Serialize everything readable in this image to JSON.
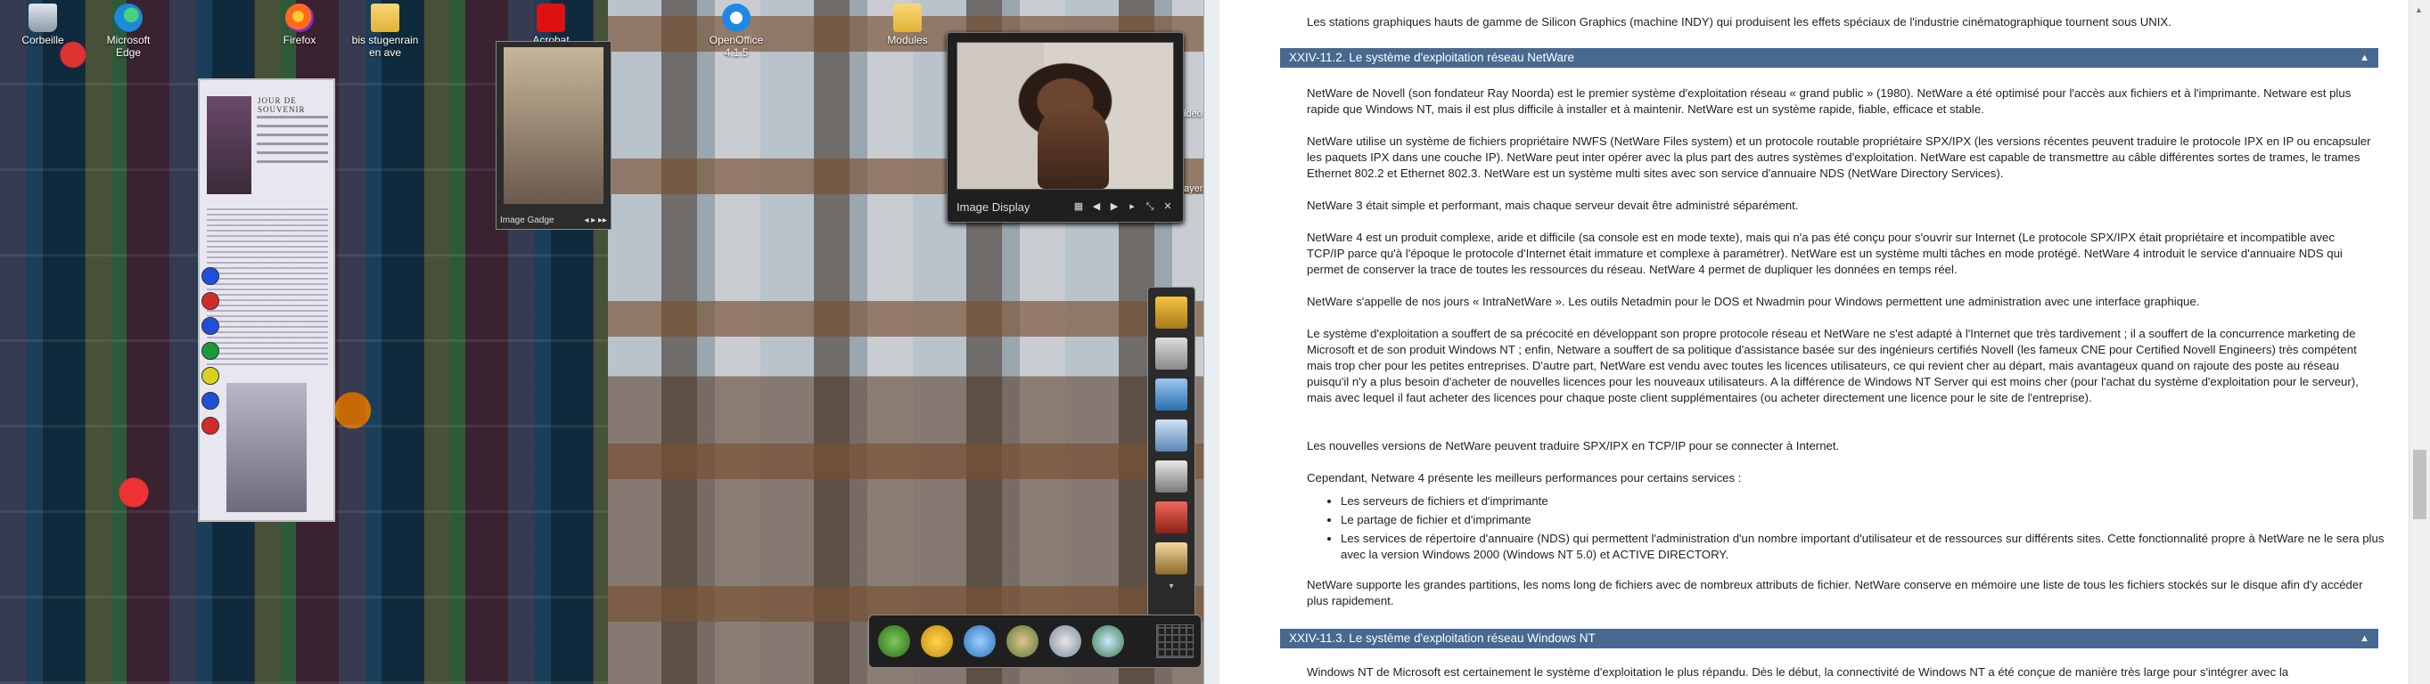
{
  "desktop": {
    "icons": [
      {
        "label": "Corbeille",
        "icon": "recycle-bin-icon"
      },
      {
        "label": "Microsoft Edge",
        "icon": "edge-icon"
      },
      {
        "label": "Firefox",
        "icon": "firefox-icon"
      },
      {
        "label": "bis stugenrain en ave",
        "icon": "folder-icon"
      },
      {
        "label": "Acrobat Reader DC",
        "icon": "pdf-icon"
      },
      {
        "label": "OpenOffice 4.1.5",
        "icon": "openoffice-icon"
      },
      {
        "label": "Modules",
        "icon": "folder-icon"
      }
    ],
    "poster_title": "JOUR DE SOUVENIR",
    "acro_widget_caption": "Image Gadge",
    "image_gadget": {
      "caption": "Image Display"
    },
    "right_edge_labels": [
      "ideo",
      "ayer"
    ]
  },
  "document": {
    "intro": "Les stations graphiques hauts de gamme de Silicon Graphics (machine INDY) qui produisent les effets spéciaux de l'industrie cinématographique tournent sous UNIX.",
    "section_netware": {
      "title": "XXIV-11.2. Le système d'exploitation réseau NetWare",
      "paragraphs": [
        "NetWare de Novell (son fondateur Ray Noorda) est le premier système d'exploitation réseau « grand public » (1980). NetWare a été optimisé pour l'accès aux fichiers et à l'imprimante. Netware est plus rapide que Windows NT, mais il est plus difficile à installer et à maintenir. NetWare est un système rapide, fiable, efficace et stable.",
        "NetWare utilise un système de fichiers propriétaire NWFS (NetWare Files system) et un protocole routable propriétaire SPX/IPX (les versions récentes peuvent traduire le protocole IPX en IP ou encapsuler les paquets IPX dans une couche IP). NetWare peut inter opérer avec la plus part des autres systèmes d'exploitation. NetWare est capable de transmettre au câble différentes sortes de trames, le trames Ethernet 802.2 et Ethernet 802.3. NetWare est un système multi sites avec son service d'annuaire NDS (NetWare Directory Services).",
        "NetWare 3 était simple et performant, mais chaque serveur devait être administré séparément.",
        "NetWare 4 est un produit complexe, aride et difficile (sa console est en mode texte), mais qui n'a pas été conçu pour s'ouvrir sur Internet (Le protocole SPX/IPX était propriétaire et incompatible avec TCP/IP parce qu'à l'époque le protocole d'Internet était immature et complexe à paramétrer). NetWare est un système multi tâches en mode protégé. NetWare 4 introduit le service d'annuaire NDS qui permet de conserver la trace de toutes les ressources du réseau. NetWare 4 permet de dupliquer les données en temps réel.",
        "NetWare s'appelle de nos jours « IntraNetWare ». Les outils Netadmin pour le DOS et Nwadmin pour Windows permettent une administration avec une interface graphique.",
        "Le système d'exploitation a souffert de sa précocité en développant son propre protocole réseau et NetWare ne s'est adapté à l'Internet que très tardivement ; il a souffert de la concurrence marketing de Microsoft et de son produit Windows NT ; enfin, Netware a souffert de sa politique d'assistance basée sur des ingénieurs certifiés Novell (les fameux CNE pour Certified Novell Engineers) très compétent mais trop cher pour les petites entreprises. D'autre part, NetWare est vendu avec toutes les licences utilisateurs, ce qui revient cher au départ, mais avantageux quand on rajoute des poste au réseau puisqu'il n'y a plus besoin d'acheter de nouvelles licences pour les nouveaux utilisateurs. A la différence de Windows NT Server qui est moins cher (pour l'achat du système d'exploitation pour le serveur), mais avec lequel il faut acheter des licences pour chaque poste client supplémentaires (ou acheter directement une licence pour le site de l'entreprise).",
        "Les nouvelles versions de NetWare peuvent traduire SPX/IPX en TCP/IP pour se connecter à Internet.",
        "Cependant, Netware 4 présente les meilleurs performances pour certains services :"
      ],
      "services": [
        "Les serveurs de fichiers et d'imprimante",
        "Le partage de fichier et d'imprimante",
        "Les services de répertoire d'annuaire (NDS) qui permettent l'administration d'un nombre important d'utilisateur et de ressources sur différents sites. Cette fonctionnalité propre à NetWare ne le sera plus avec la version Windows 2000 (Windows NT 5.0) et ACTIVE DIRECTORY."
      ],
      "closing": "NetWare supporte les grandes partitions, les noms long de fichiers avec de nombreux attributs de fichier. NetWare conserve en mémoire une liste de tous les fichiers stockés sur le disque afin d'y accéder plus rapidement."
    },
    "section_nt": {
      "title": "XXIV-11.3. Le système d'exploitation réseau Windows NT",
      "first_line": "Windows NT de Microsoft est certainement le système d'exploitation le plus répandu. Dès le début, la connectivité de Windows NT a été conçue de manière très large pour s'intégrer avec la"
    },
    "collapse_glyph": "▲"
  },
  "colors": {
    "section_bar": "#47698f",
    "text": "#222222"
  }
}
